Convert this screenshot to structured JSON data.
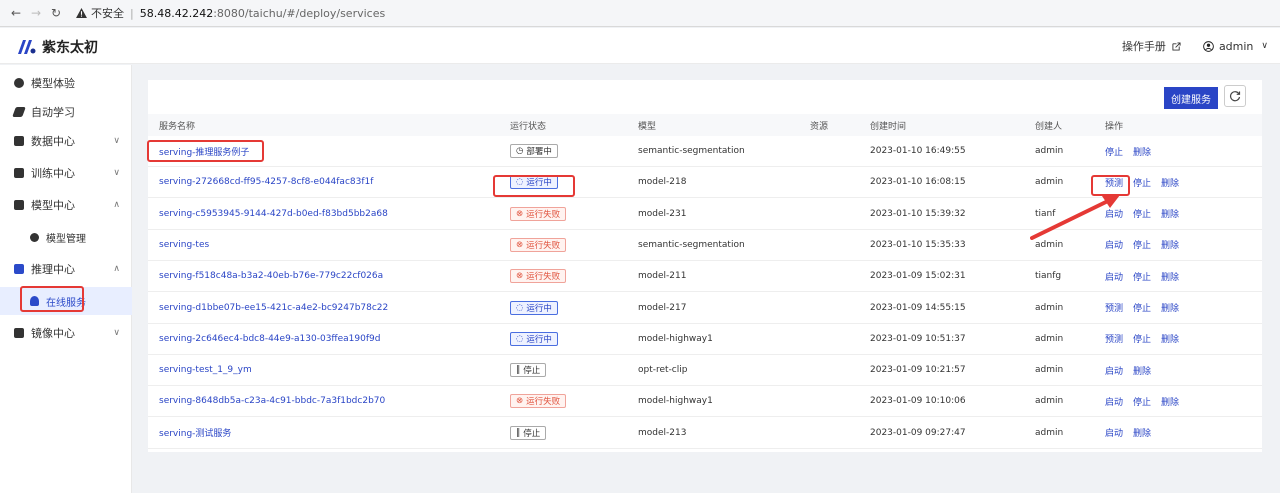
{
  "browser": {
    "insecure_label": "不安全",
    "url_host": "58.48.42.242",
    "url_rest": ":8080/taichu/#/deploy/services"
  },
  "header": {
    "logo_text": "紫东太初",
    "manual_label": "操作手册",
    "user_label": "admin"
  },
  "sidebar": {
    "items": [
      {
        "label": "模型体验",
        "icon": "cube-icon"
      },
      {
        "label": "自动学习",
        "icon": "pen-icon"
      },
      {
        "label": "数据中心",
        "icon": "database-icon"
      },
      {
        "label": "训练中心",
        "icon": "train-icon"
      },
      {
        "label": "模型中心",
        "icon": "grid-icon"
      },
      {
        "label": "模型管理",
        "icon": "settings-icon"
      },
      {
        "label": "推理中心",
        "icon": "chart-icon"
      },
      {
        "label": "在线服务",
        "icon": "user-icon"
      },
      {
        "label": "镜像中心",
        "icon": "image-icon"
      }
    ]
  },
  "toolbar": {
    "create_label": "创建服务"
  },
  "table": {
    "headers": [
      "服务名称",
      "运行状态",
      "模型",
      "资源",
      "创建时间",
      "创建人",
      "操作"
    ],
    "rows": [
      {
        "name": "serving-推理服务例子",
        "status": "部署中",
        "status_type": "deploy",
        "model": "semantic-segmentation",
        "time": "2023-01-10 16:49:55",
        "creator": "admin",
        "actions": [
          "停止",
          "删除"
        ]
      },
      {
        "name": "serving-272668cd-ff95-4257-8cf8-e044fac83f1f",
        "status": "运行中",
        "status_type": "run",
        "model": "model-218",
        "time": "2023-01-10 16:08:15",
        "creator": "admin",
        "actions": [
          "预测",
          "停止",
          "删除"
        ]
      },
      {
        "name": "serving-c5953945-9144-427d-b0ed-f83bd5bb2a68",
        "status": "运行失败",
        "status_type": "fail",
        "model": "model-231",
        "time": "2023-01-10 15:39:32",
        "creator": "tianf",
        "actions": [
          "启动",
          "停止",
          "删除"
        ]
      },
      {
        "name": "serving-tes",
        "status": "运行失败",
        "status_type": "fail",
        "model": "semantic-segmentation",
        "time": "2023-01-10 15:35:33",
        "creator": "admin",
        "actions": [
          "启动",
          "停止",
          "删除"
        ]
      },
      {
        "name": "serving-f518c48a-b3a2-40eb-b76e-779c22cf026a",
        "status": "运行失败",
        "status_type": "fail",
        "model": "model-211",
        "time": "2023-01-09 15:02:31",
        "creator": "tianfg",
        "actions": [
          "启动",
          "停止",
          "删除"
        ]
      },
      {
        "name": "serving-d1bbe07b-ee15-421c-a4e2-bc9247b78c22",
        "status": "运行中",
        "status_type": "run",
        "model": "model-217",
        "time": "2023-01-09 14:55:15",
        "creator": "admin",
        "actions": [
          "预测",
          "停止",
          "删除"
        ]
      },
      {
        "name": "serving-2c646ec4-bdc8-44e9-a130-03ffea190f9d",
        "status": "运行中",
        "status_type": "run",
        "model": "model-highway1",
        "time": "2023-01-09 10:51:37",
        "creator": "admin",
        "actions": [
          "预测",
          "停止",
          "删除"
        ]
      },
      {
        "name": "serving-test_1_9_ym",
        "status": "停止",
        "status_type": "stop",
        "model": "opt-ret-clip",
        "time": "2023-01-09 10:21:57",
        "creator": "admin",
        "actions": [
          "启动",
          "删除"
        ]
      },
      {
        "name": "serving-8648db5a-c23a-4c91-bbdc-7a3f1bdc2b70",
        "status": "运行失败",
        "status_type": "fail",
        "model": "model-highway1",
        "time": "2023-01-09 10:10:06",
        "creator": "admin",
        "actions": [
          "启动",
          "停止",
          "删除"
        ]
      },
      {
        "name": "serving-测试服务",
        "status": "停止",
        "status_type": "stop",
        "model": "model-213",
        "time": "2023-01-09 09:27:47",
        "creator": "admin",
        "actions": [
          "启动",
          "删除"
        ]
      }
    ]
  },
  "colors": {
    "accent": "#2a45c6",
    "highlight": "#e53935"
  }
}
